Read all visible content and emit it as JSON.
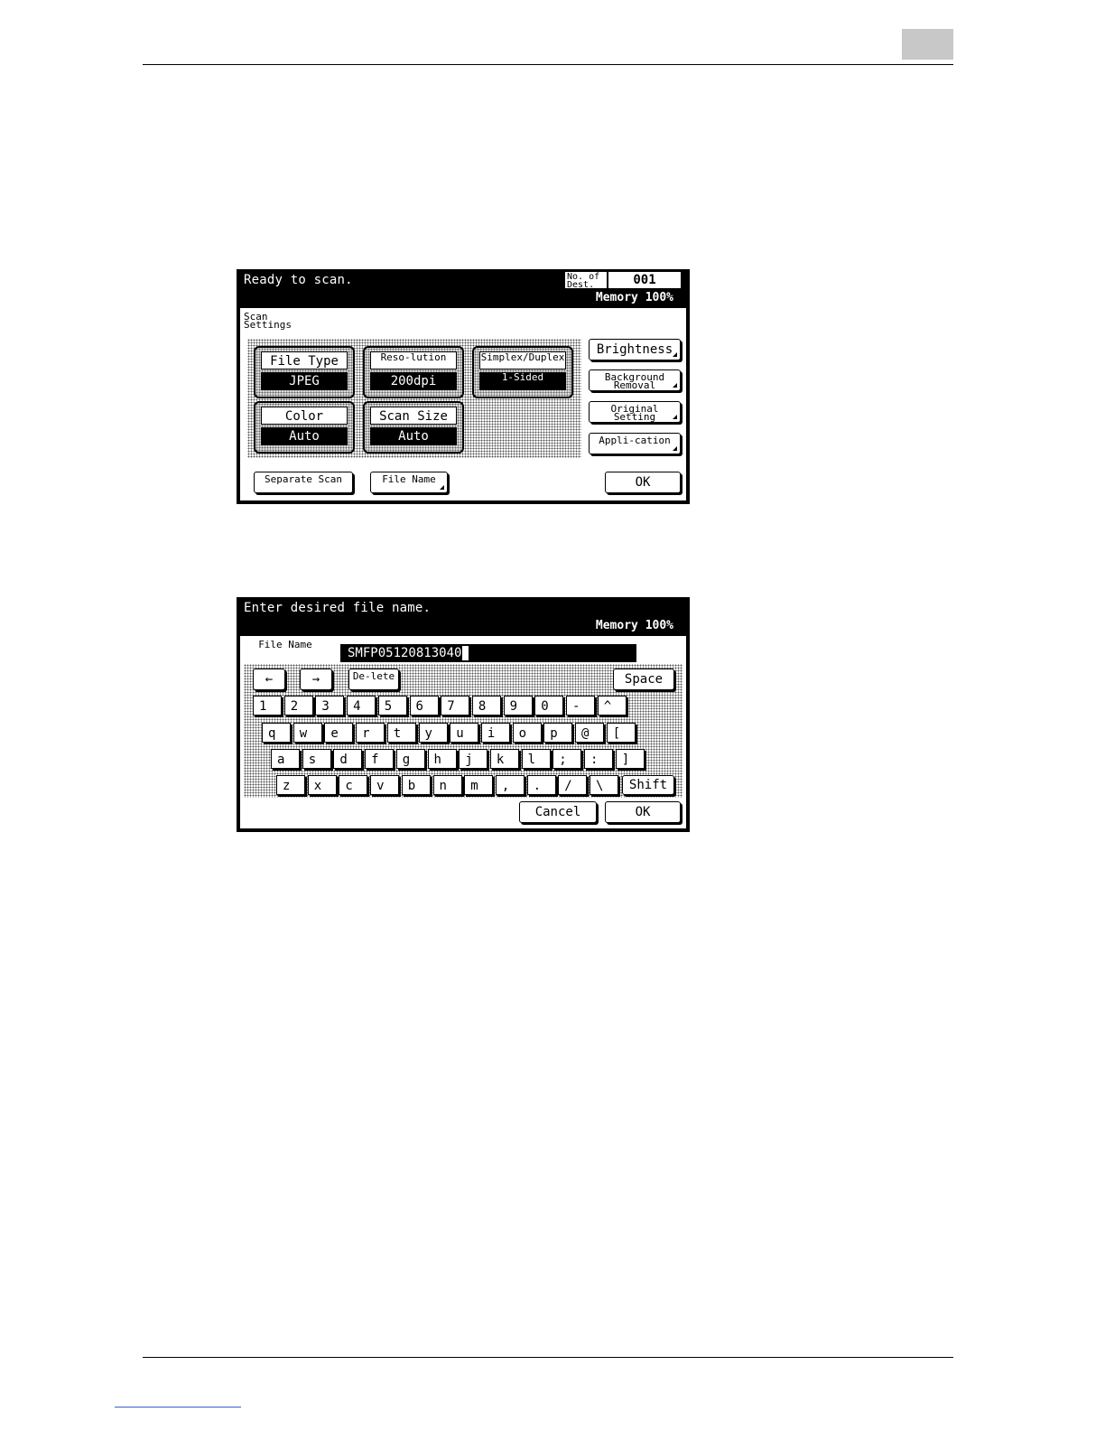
{
  "screen1": {
    "status": "Ready to scan.",
    "dest_label": "No. of Dest.",
    "dest_value": "001",
    "memory_label": "Memory",
    "memory_value": "100%",
    "section_label": "Scan Settings",
    "groups": [
      {
        "label": "File Type",
        "value": "JPEG"
      },
      {
        "label": "Reso-lution",
        "value": "200dpi"
      },
      {
        "label": "Simplex/Duplex",
        "value": "1-Sided"
      },
      {
        "label": "Color",
        "value": "Auto"
      },
      {
        "label": "Scan Size",
        "value": "Auto"
      }
    ],
    "side_buttons": [
      "Brightness",
      "Background Removal",
      "Original Setting",
      "Appli-cation"
    ],
    "bottom_buttons": {
      "separate_scan": "Separate Scan",
      "file_name": "File Name",
      "ok": "OK"
    }
  },
  "screen2": {
    "status": "Enter desired file name.",
    "memory_label": "Memory",
    "memory_value": "100%",
    "field_label": "File Name",
    "field_value": "SMFP05120813040",
    "nav": {
      "left": "←",
      "right": "→",
      "delete": "De-lete",
      "space": "Space"
    },
    "rows": [
      [
        "1",
        "2",
        "3",
        "4",
        "5",
        "6",
        "7",
        "8",
        "9",
        "0",
        "-",
        "^"
      ],
      [
        "q",
        "w",
        "e",
        "r",
        "t",
        "y",
        "u",
        "i",
        "o",
        "p",
        "@",
        "["
      ],
      [
        "a",
        "s",
        "d",
        "f",
        "g",
        "h",
        "j",
        "k",
        "l",
        ";",
        ":",
        "]"
      ],
      [
        "z",
        "x",
        "c",
        "v",
        "b",
        "n",
        "m",
        ",",
        ".",
        "/",
        "\\"
      ]
    ],
    "shift": "Shift",
    "cancel": "Cancel",
    "ok": "OK"
  }
}
